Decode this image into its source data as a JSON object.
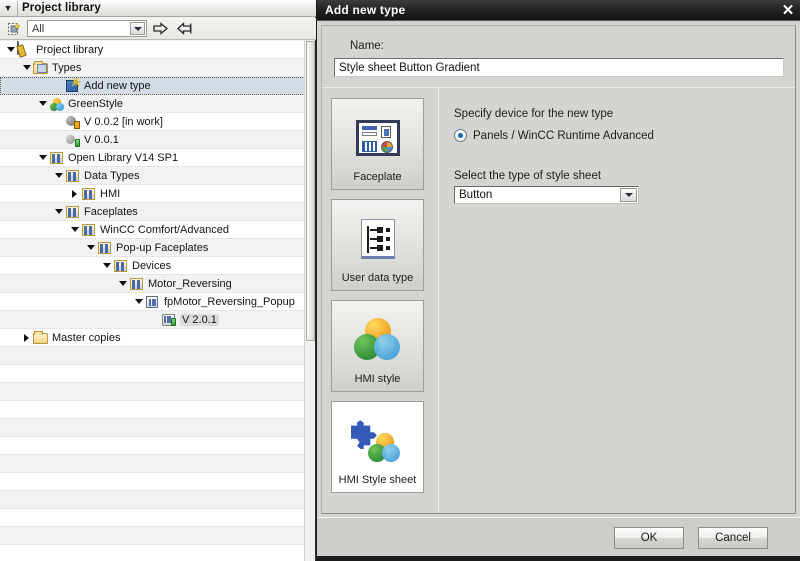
{
  "library_panel": {
    "title": "Project library",
    "collapse_icon": "chevron-down-icon",
    "toolbar": {
      "new_icon": "new-library-icon",
      "filter_value": "All",
      "filter_arrow_icon": "chevron-down-icon",
      "open_icon": "arrow-right-icon",
      "import_icon": "arrow-left-icon"
    },
    "tree": [
      {
        "label": "Project library",
        "indent": 0,
        "twisty": "open",
        "icon": "library-icon",
        "state": "normal"
      },
      {
        "label": "Types",
        "indent": 1,
        "twisty": "open",
        "icon": "folder-types-icon",
        "state": "normal"
      },
      {
        "label": "Add new type",
        "indent": 3,
        "twisty": "none",
        "icon": "add-new-type-icon",
        "state": "selected"
      },
      {
        "label": "GreenStyle",
        "indent": 2,
        "twisty": "open",
        "icon": "hmi-style-icon",
        "state": "normal"
      },
      {
        "label": "V 0.0.2 [in work]",
        "indent": 3,
        "twisty": "none",
        "icon": "version-inwork-icon",
        "state": "normal"
      },
      {
        "label": "V 0.0.1",
        "indent": 3,
        "twisty": "none",
        "icon": "version-released-icon",
        "state": "normal"
      },
      {
        "label": "Open Library V14 SP1",
        "indent": 2,
        "twisty": "open",
        "icon": "type-folder-icon",
        "state": "normal"
      },
      {
        "label": "Data Types",
        "indent": 3,
        "twisty": "open",
        "icon": "type-folder-icon",
        "state": "normal"
      },
      {
        "label": "HMI",
        "indent": 4,
        "twisty": "closed",
        "icon": "type-folder-icon",
        "state": "normal"
      },
      {
        "label": "Faceplates",
        "indent": 3,
        "twisty": "open",
        "icon": "type-folder-icon",
        "state": "normal"
      },
      {
        "label": "WinCC Comfort/Advanced",
        "indent": 4,
        "twisty": "open",
        "icon": "type-folder-icon",
        "state": "normal"
      },
      {
        "label": "Pop-up Faceplates",
        "indent": 5,
        "twisty": "open",
        "icon": "type-folder-icon",
        "state": "normal"
      },
      {
        "label": "Devices",
        "indent": 6,
        "twisty": "open",
        "icon": "type-folder-icon",
        "state": "normal"
      },
      {
        "label": "Motor_Reversing",
        "indent": 7,
        "twisty": "open",
        "icon": "type-folder-icon",
        "state": "normal"
      },
      {
        "label": "fpMotor_Reversing_Popup",
        "indent": 8,
        "twisty": "open",
        "icon": "faceplate-icon",
        "state": "normal"
      },
      {
        "label": "V 2.0.1",
        "indent": 9,
        "twisty": "none",
        "icon": "faceplate-version-icon",
        "state": "highlight"
      },
      {
        "label": "Master copies",
        "indent": 1,
        "twisty": "closed",
        "icon": "folder-plain-icon",
        "state": "normal"
      }
    ]
  },
  "dialog": {
    "title": "Add new type",
    "close_icon": "close-icon",
    "name_label": "Name:",
    "name_value": "Style sheet Button Gradient",
    "name_placeholder": "",
    "tiles": [
      {
        "label": "Faceplate",
        "art": "faceplate-art",
        "selected": false
      },
      {
        "label": "User data type",
        "art": "user-data-type-art",
        "selected": false
      },
      {
        "label": "HMI style",
        "art": "hmi-style-art",
        "selected": false
      },
      {
        "label": "HMI Style sheet",
        "art": "hmi-style-sheet-art",
        "selected": true
      }
    ],
    "options": {
      "device_heading": "Specify device for the new type",
      "device_radio_label": "Panels / WinCC Runtime Advanced",
      "device_radio_checked": true,
      "stylesheet_heading": "Select the type of style sheet",
      "stylesheet_value": "Button",
      "stylesheet_arrow_icon": "chevron-down-icon"
    },
    "footer": {
      "ok_label": "OK",
      "cancel_label": "Cancel"
    }
  },
  "colors": {
    "dialog_titlebar": "#232323",
    "dialog_face": "#d4d4d0",
    "selection_blue": "#d3dbe5",
    "radio_accent": "#1569b0"
  }
}
